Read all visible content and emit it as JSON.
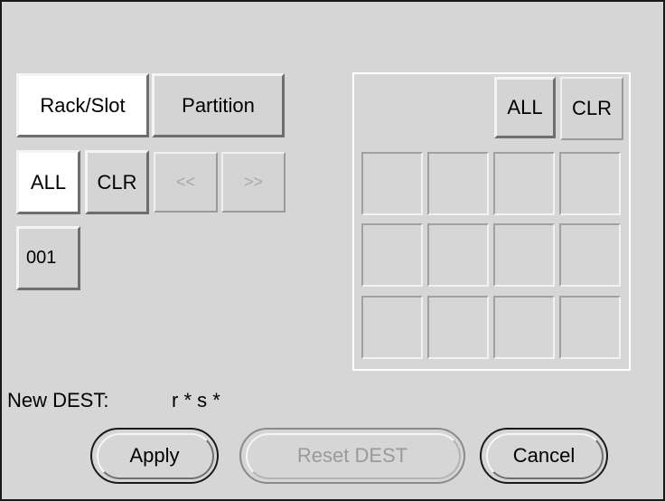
{
  "view_tabs": {
    "rack_slot": "Rack/Slot",
    "partition": "Partition"
  },
  "rack_controls": {
    "all": "ALL",
    "clr": "CLR",
    "prev": "<<",
    "next": ">>"
  },
  "racks": [
    "001"
  ],
  "slot_panel": {
    "all": "ALL",
    "clr": "CLR",
    "rows": 3,
    "cols": 4
  },
  "destination": {
    "label": "New DEST:",
    "value": "r * s *"
  },
  "actions": {
    "apply": "Apply",
    "reset": "Reset DEST",
    "cancel": "Cancel"
  },
  "colors": {
    "background": "#d6d6d6",
    "selected": "#ffffff",
    "disabled_text": "#a8a8a8"
  }
}
